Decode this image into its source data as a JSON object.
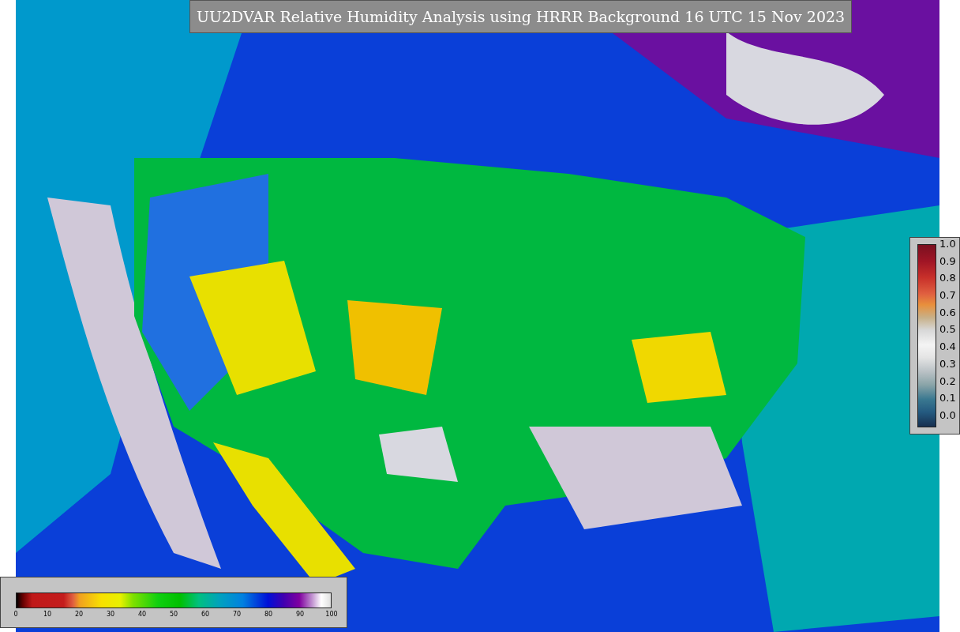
{
  "title": "UU2DVAR Relative Humidity Analysis using HRRR Background 16 UTC 15 Nov 2023",
  "side_colorbar": {
    "ticks": [
      "1.0",
      "0.9",
      "0.8",
      "0.7",
      "0.6",
      "0.5",
      "0.4",
      "0.3",
      "0.2",
      "0.1",
      "0.0"
    ]
  },
  "bottom_colorbar": {
    "ticks": [
      "0",
      "10",
      "20",
      "30",
      "40",
      "50",
      "60",
      "70",
      "80",
      "90",
      "100"
    ]
  }
}
